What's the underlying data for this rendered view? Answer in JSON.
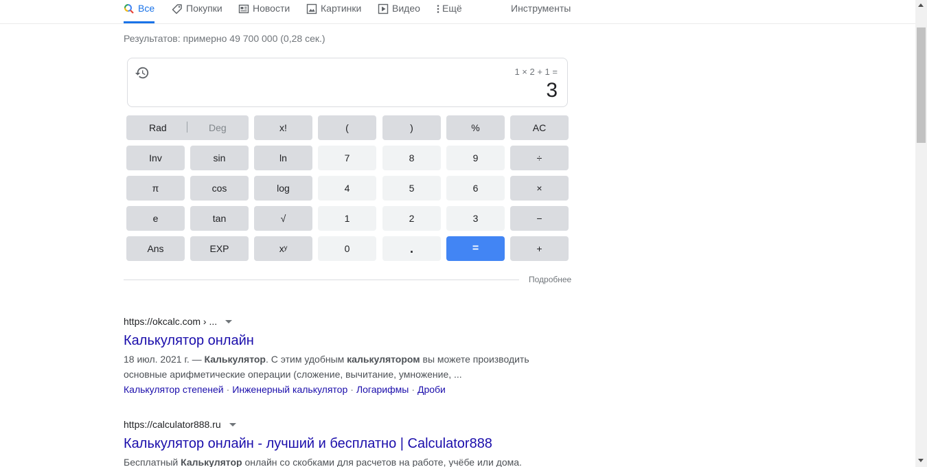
{
  "tabs": [
    {
      "label": "Все",
      "icon": "search-icon"
    },
    {
      "label": "Покупки",
      "icon": "tag-icon"
    },
    {
      "label": "Новости",
      "icon": "news-icon"
    },
    {
      "label": "Картинки",
      "icon": "image-icon"
    },
    {
      "label": "Видео",
      "icon": "video-icon"
    },
    {
      "label": "Ещё",
      "icon": "more-vert-icon"
    }
  ],
  "tools_label": "Инструменты",
  "result_stats": "Результатов: примерно 49 700 000 (0,28 сек.)",
  "calculator": {
    "expression": "1 × 2 + 1 =",
    "result": "3",
    "rad_label": "Rad",
    "deg_label": "Deg",
    "keys": {
      "fact": "x!",
      "lparen": "(",
      "rparen": ")",
      "percent": "%",
      "ac": "AC",
      "inv": "Inv",
      "sin": "sin",
      "ln": "ln",
      "k7": "7",
      "k8": "8",
      "k9": "9",
      "divide": "÷",
      "pi": "π",
      "cos": "cos",
      "log": "log",
      "k4": "4",
      "k5": "5",
      "k6": "6",
      "multiply": "×",
      "e": "e",
      "tan": "tan",
      "sqrt": "√",
      "k1": "1",
      "k2": "2",
      "k3": "3",
      "minus": "−",
      "ans": "Ans",
      "exp": "EXP",
      "pow": "xʸ",
      "k0": "0",
      "dot": ".",
      "equals": "=",
      "plus": "+"
    },
    "more_link": "Подробнее"
  },
  "results": [
    {
      "url": "https://okcalc.com › ...",
      "title": "Калькулятор онлайн",
      "snippet_date": "18 июл. 2021 г. — ",
      "snippet_b1": "Калькулятор",
      "snippet_t1": ". С этим удобным ",
      "snippet_b2": "калькулятором",
      "snippet_t2": " вы можете производить",
      "snippet_line2": "основные арифметические операции (сложение, вычитание, умножение, ...",
      "sitelinks": [
        "Калькулятор степеней",
        "Инженерный калькулятор",
        "Логарифмы",
        "Дроби"
      ]
    },
    {
      "url": "https://calculator888.ru",
      "title": "Калькулятор онлайн - лучший и бесплатно | Calculator888",
      "snippet_t0": "Бесплатный ",
      "snippet_b1": "Калькулятор",
      "snippet_t1": " онлайн со скобками для расчетов на работе, учёбе или дома."
    }
  ]
}
